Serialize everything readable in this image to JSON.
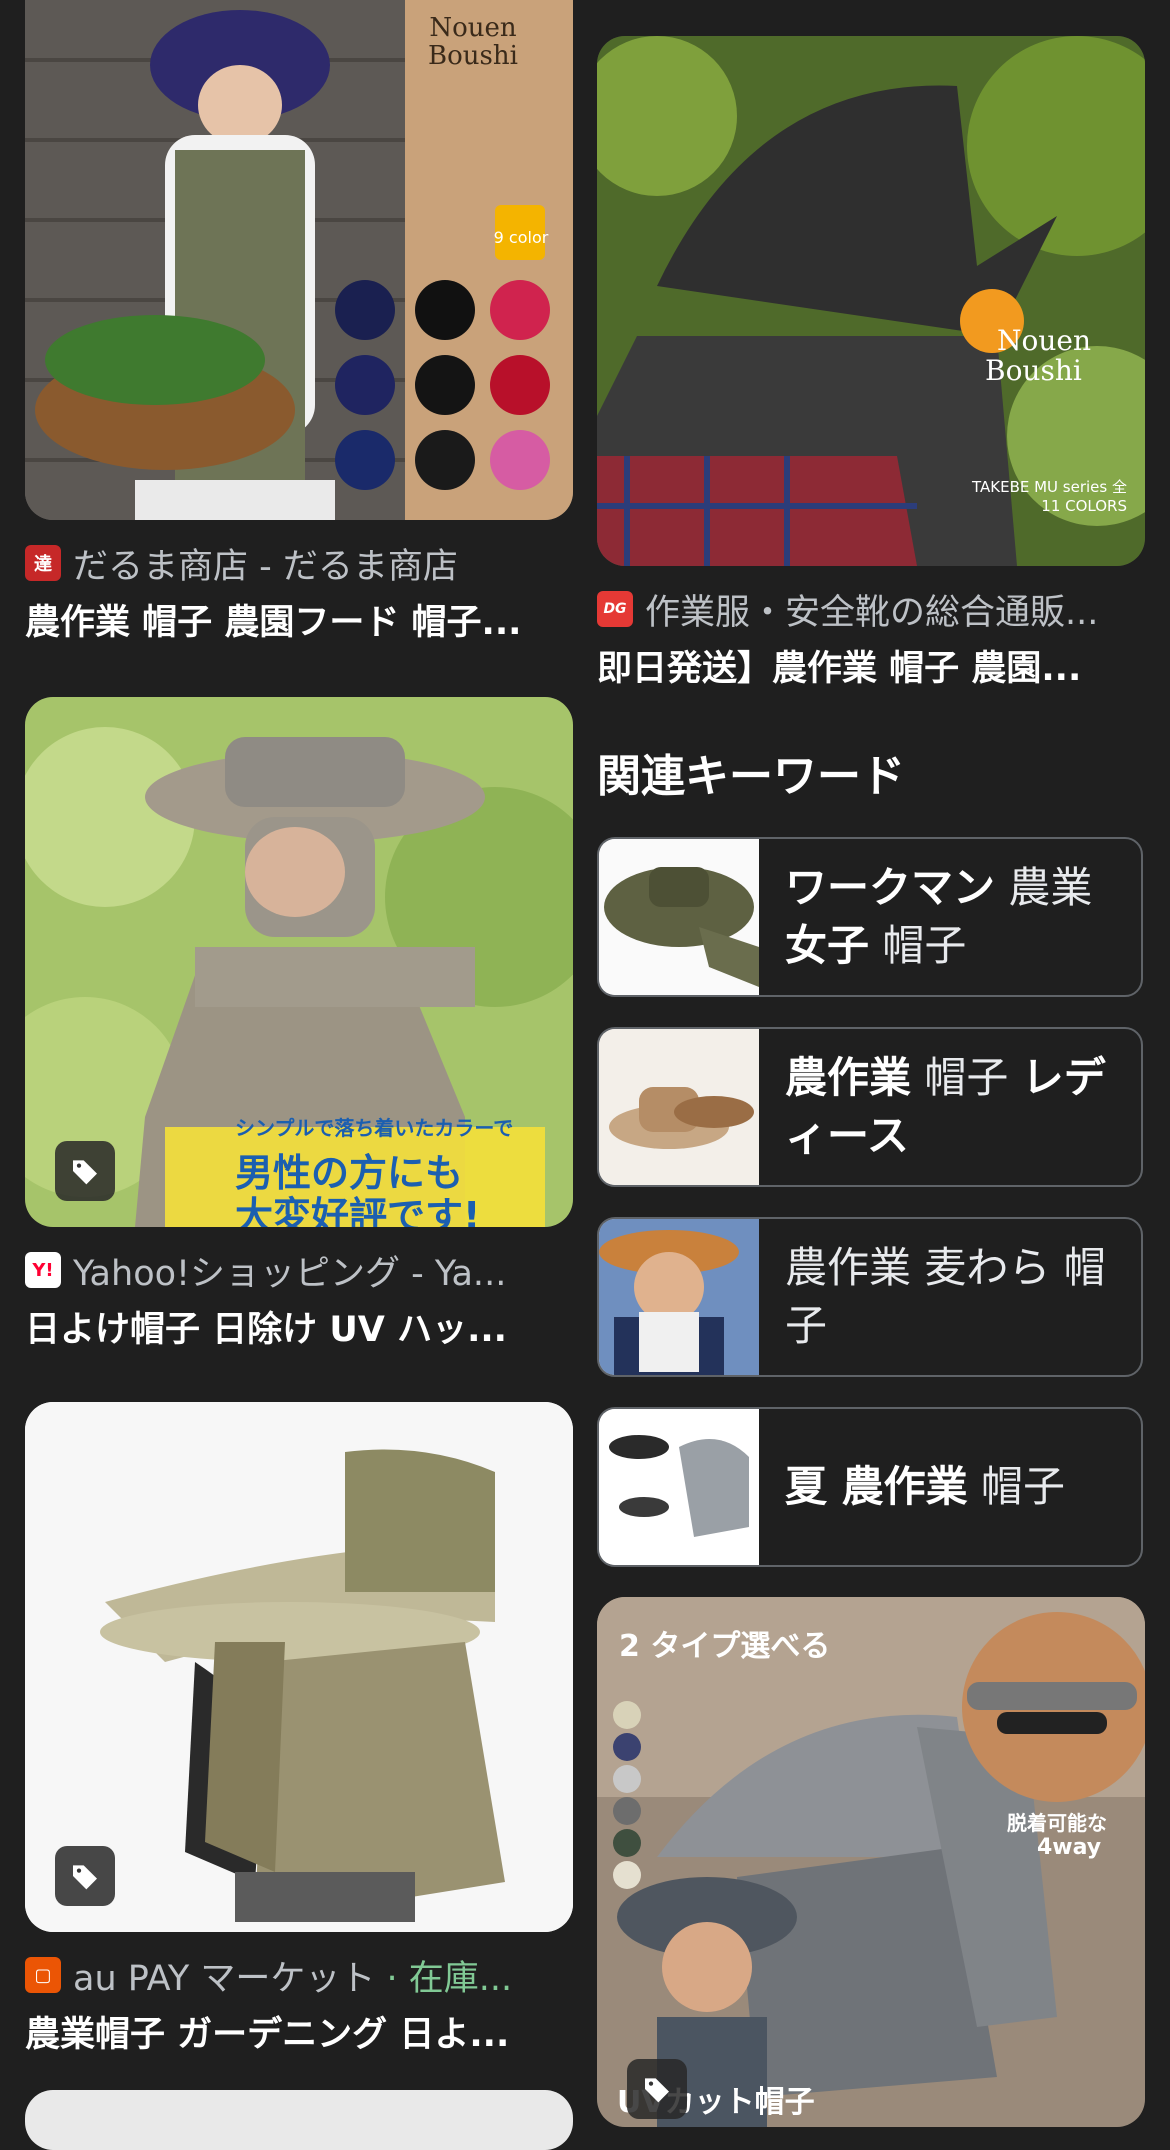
{
  "results_left": [
    {
      "source": "だるま商店 - だるま商店",
      "title": "農作業 帽子 農園フード 帽子...",
      "favicon": "daruma-icon",
      "favicon_color": "#c62828",
      "badge": false,
      "image_label": "Nouen Boushi",
      "image_sub": "9 color"
    },
    {
      "source": "Yahoo!ショッピング - Ya...",
      "title": "日よけ帽子 日除け UV ハッ...",
      "favicon": "yahoo-icon",
      "favicon_color": "#ff0033",
      "favicon_text": "Y!",
      "badge": true,
      "image_caption_1": "シンプルで落ち着いたカラーで",
      "image_caption_2": "男性の方にも",
      "image_caption_3": "大変好評です!"
    },
    {
      "source": "au PAY マーケット",
      "stock": " · 在庫...",
      "title": "農業帽子 ガーデニング 日よ...",
      "favicon": "au-pay-icon",
      "favicon_color": "#eb5505",
      "badge": true
    }
  ],
  "results_right": [
    {
      "source": "作業服・安全靴の総合通販...",
      "title": "即日発送】農作業 帽子 農園...",
      "favicon": "dg-icon",
      "favicon_color": "#e53935",
      "favicon_text": "DG",
      "image_label_1": "Nouen",
      "image_label_2": "Boushi",
      "image_sub": "TAKEBE MU series 全11 COLORS"
    }
  ],
  "related": {
    "heading": "関連キーワード",
    "items": [
      {
        "plain_1": "",
        "bold_1": "ワークマン",
        "plain_2": " 農業 ",
        "bold_2": "女子",
        "plain_3": " 帽子"
      },
      {
        "plain_1": "",
        "bold_1": "農作業",
        "plain_2": " 帽子 ",
        "bold_2": "レディース",
        "plain_3": ""
      },
      {
        "plain_1": "農作業 麦わら 帽子",
        "bold_1": "",
        "plain_2": "",
        "bold_2": "",
        "plain_3": ""
      },
      {
        "plain_1": "",
        "bold_1": "夏 農作業",
        "plain_2": " 帽子",
        "bold_2": "",
        "plain_3": ""
      }
    ]
  },
  "bottom_right_card": {
    "caption_top": "2 タイプ選べる",
    "caption_right_1": "脱着可能な",
    "caption_right_2": "4way",
    "caption_bottom": "UVカット帽子",
    "badge": true
  }
}
